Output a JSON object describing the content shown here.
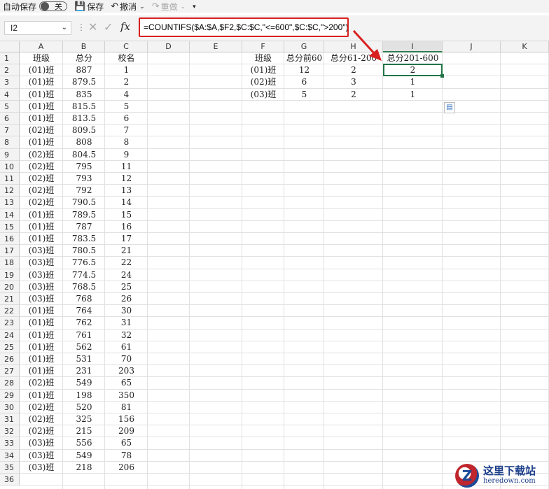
{
  "toolbar": {
    "autosave_label": "自动保存",
    "autosave_state": "关",
    "save_label": "保存",
    "undo_label": "撤消",
    "redo_label": "重做"
  },
  "formula_bar": {
    "name_box": "I2",
    "formula": "=COUNTIFS($A:$A,$F2,$C:$C,\"<=600\",$C:$C,\">200\")"
  },
  "sheet": {
    "columns": [
      "A",
      "B",
      "C",
      "D",
      "E",
      "F",
      "G",
      "H",
      "I",
      "J",
      "K"
    ],
    "selected_column": "I",
    "rows": [
      "1",
      "2",
      "3",
      "4",
      "5",
      "6",
      "7",
      "8",
      "9",
      "10",
      "11",
      "12",
      "13",
      "14",
      "15",
      "16",
      "17",
      "18",
      "19",
      "20",
      "21",
      "22",
      "23",
      "24",
      "25",
      "26",
      "27",
      "28",
      "29",
      "30",
      "31",
      "32",
      "33",
      "34",
      "35",
      "36"
    ],
    "selected_cell": "I2",
    "left_table": {
      "headers": [
        "班级",
        "总分",
        "校名"
      ],
      "data": [
        [
          "(01)班",
          "887",
          "1"
        ],
        [
          "(01)班",
          "879.5",
          "2"
        ],
        [
          "(01)班",
          "835",
          "4"
        ],
        [
          "(01)班",
          "815.5",
          "5"
        ],
        [
          "(01)班",
          "813.5",
          "6"
        ],
        [
          "(02)班",
          "809.5",
          "7"
        ],
        [
          "(01)班",
          "808",
          "8"
        ],
        [
          "(02)班",
          "804.5",
          "9"
        ],
        [
          "(02)班",
          "795",
          "11"
        ],
        [
          "(02)班",
          "793",
          "12"
        ],
        [
          "(02)班",
          "792",
          "13"
        ],
        [
          "(02)班",
          "790.5",
          "14"
        ],
        [
          "(01)班",
          "789.5",
          "15"
        ],
        [
          "(01)班",
          "787",
          "16"
        ],
        [
          "(01)班",
          "783.5",
          "17"
        ],
        [
          "(03)班",
          "780.5",
          "21"
        ],
        [
          "(03)班",
          "776.5",
          "22"
        ],
        [
          "(03)班",
          "774.5",
          "24"
        ],
        [
          "(03)班",
          "768.5",
          "25"
        ],
        [
          "(03)班",
          "768",
          "26"
        ],
        [
          "(01)班",
          "764",
          "30"
        ],
        [
          "(01)班",
          "762",
          "31"
        ],
        [
          "(01)班",
          "761",
          "32"
        ],
        [
          "(01)班",
          "562",
          "61"
        ],
        [
          "(01)班",
          "531",
          "70"
        ],
        [
          "(01)班",
          "231",
          "203"
        ],
        [
          "(02)班",
          "549",
          "65"
        ],
        [
          "(01)班",
          "198",
          "350"
        ],
        [
          "(02)班",
          "520",
          "81"
        ],
        [
          "(02)班",
          "325",
          "156"
        ],
        [
          "(02)班",
          "215",
          "209"
        ],
        [
          "(03)班",
          "556",
          "65"
        ],
        [
          "(03)班",
          "549",
          "78"
        ],
        [
          "(03)班",
          "218",
          "206"
        ]
      ]
    },
    "right_table": {
      "headers": [
        "班级",
        "总分前60",
        "总分61-200",
        "总分201-600"
      ],
      "data": [
        [
          "(01)班",
          "12",
          "2",
          "2"
        ],
        [
          "(02)班",
          "6",
          "3",
          "1"
        ],
        [
          "(03)班",
          "5",
          "2",
          "1"
        ]
      ]
    }
  },
  "watermark": {
    "cn": "这里下载站",
    "en": "heredown.com"
  },
  "colors": {
    "accent_red": "#d92020",
    "selection_green": "#217346"
  }
}
